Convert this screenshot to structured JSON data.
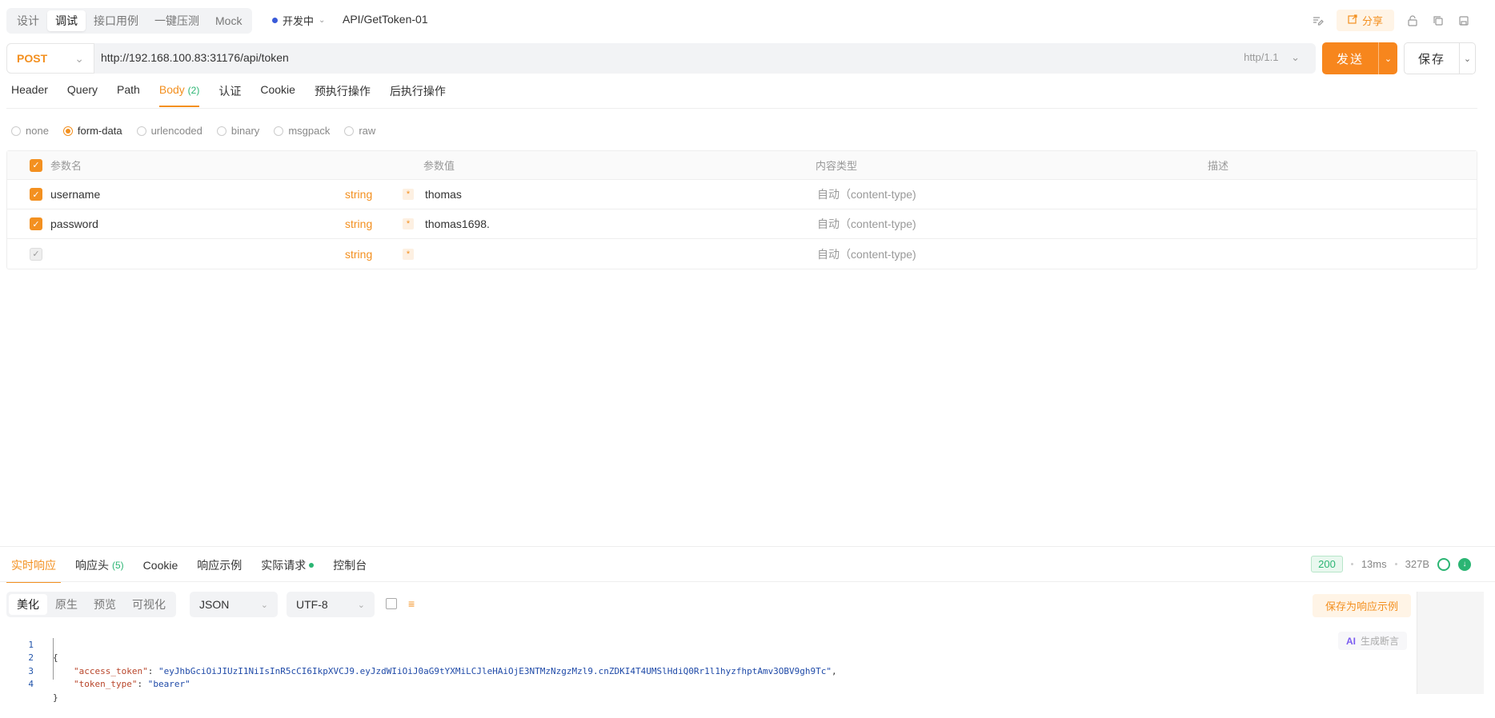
{
  "header": {
    "modes": [
      "设计",
      "调试",
      "接口用例",
      "一键压测",
      "Mock"
    ],
    "active_mode": "调试",
    "status": "开发中",
    "api_name": "API/GetToken-01",
    "share_label": "分享"
  },
  "request": {
    "method": "POST",
    "url": "http://192.168.100.83:31176/api/token",
    "http_version": "http/1.1",
    "send_label": "发送",
    "save_label": "保存"
  },
  "tabs": [
    {
      "label": "Header"
    },
    {
      "label": "Query"
    },
    {
      "label": "Path"
    },
    {
      "label": "Body",
      "count": "(2)"
    },
    {
      "label": "认证"
    },
    {
      "label": "Cookie"
    },
    {
      "label": "预执行操作"
    },
    {
      "label": "后执行操作"
    }
  ],
  "body_types": [
    "none",
    "form-data",
    "urlencoded",
    "binary",
    "msgpack",
    "raw"
  ],
  "selected_body_type": "form-data",
  "params_table": {
    "headers": {
      "name": "参数名",
      "value": "参数值",
      "content_type": "内容类型",
      "description": "描述"
    },
    "rows": [
      {
        "name": "username",
        "type": "string",
        "required": "*",
        "value": "thomas",
        "content_type": "自动（content-type)",
        "checked": true
      },
      {
        "name": "password",
        "type": "string",
        "required": "*",
        "value": "thomas1698.",
        "content_type": "自动（content-type)",
        "checked": true
      },
      {
        "name": "",
        "type": "string",
        "required": "*",
        "value": "",
        "content_type": "自动（content-type)",
        "checked": false
      }
    ]
  },
  "response": {
    "tabs": [
      {
        "label": "实时响应"
      },
      {
        "label": "响应头",
        "count": "(5)"
      },
      {
        "label": "Cookie"
      },
      {
        "label": "响应示例"
      },
      {
        "label": "实际请求"
      },
      {
        "label": "控制台"
      }
    ],
    "status_code": "200",
    "time": "13ms",
    "size": "327B",
    "view_tabs": [
      "美化",
      "原生",
      "预览",
      "可视化"
    ],
    "format": "JSON",
    "encoding": "UTF-8",
    "save_example_label": "保存为响应示例",
    "ai_label": "生成断言",
    "ai_badge": "AI",
    "code_lines": [
      {
        "num": "1",
        "text": "{"
      },
      {
        "num": "2",
        "key": "\"access_token\"",
        "sep": ": ",
        "val": "\"eyJhbGciOiJIUzI1NiIsInR5cCI6IkpXVCJ9.eyJzdWIiOiJ0aG9tYXMiLCJleHAiOjE3NTMzNzgzMzl9.cnZDKI4T4UMSlHdiQ0Rr1l1hyzfhptAmv3OBV9gh9Tc\"",
        "tail": ","
      },
      {
        "num": "3",
        "key": "\"token_type\"",
        "sep": ": ",
        "val": "\"bearer\"",
        "tail": ""
      },
      {
        "num": "4",
        "text": "}"
      }
    ]
  }
}
